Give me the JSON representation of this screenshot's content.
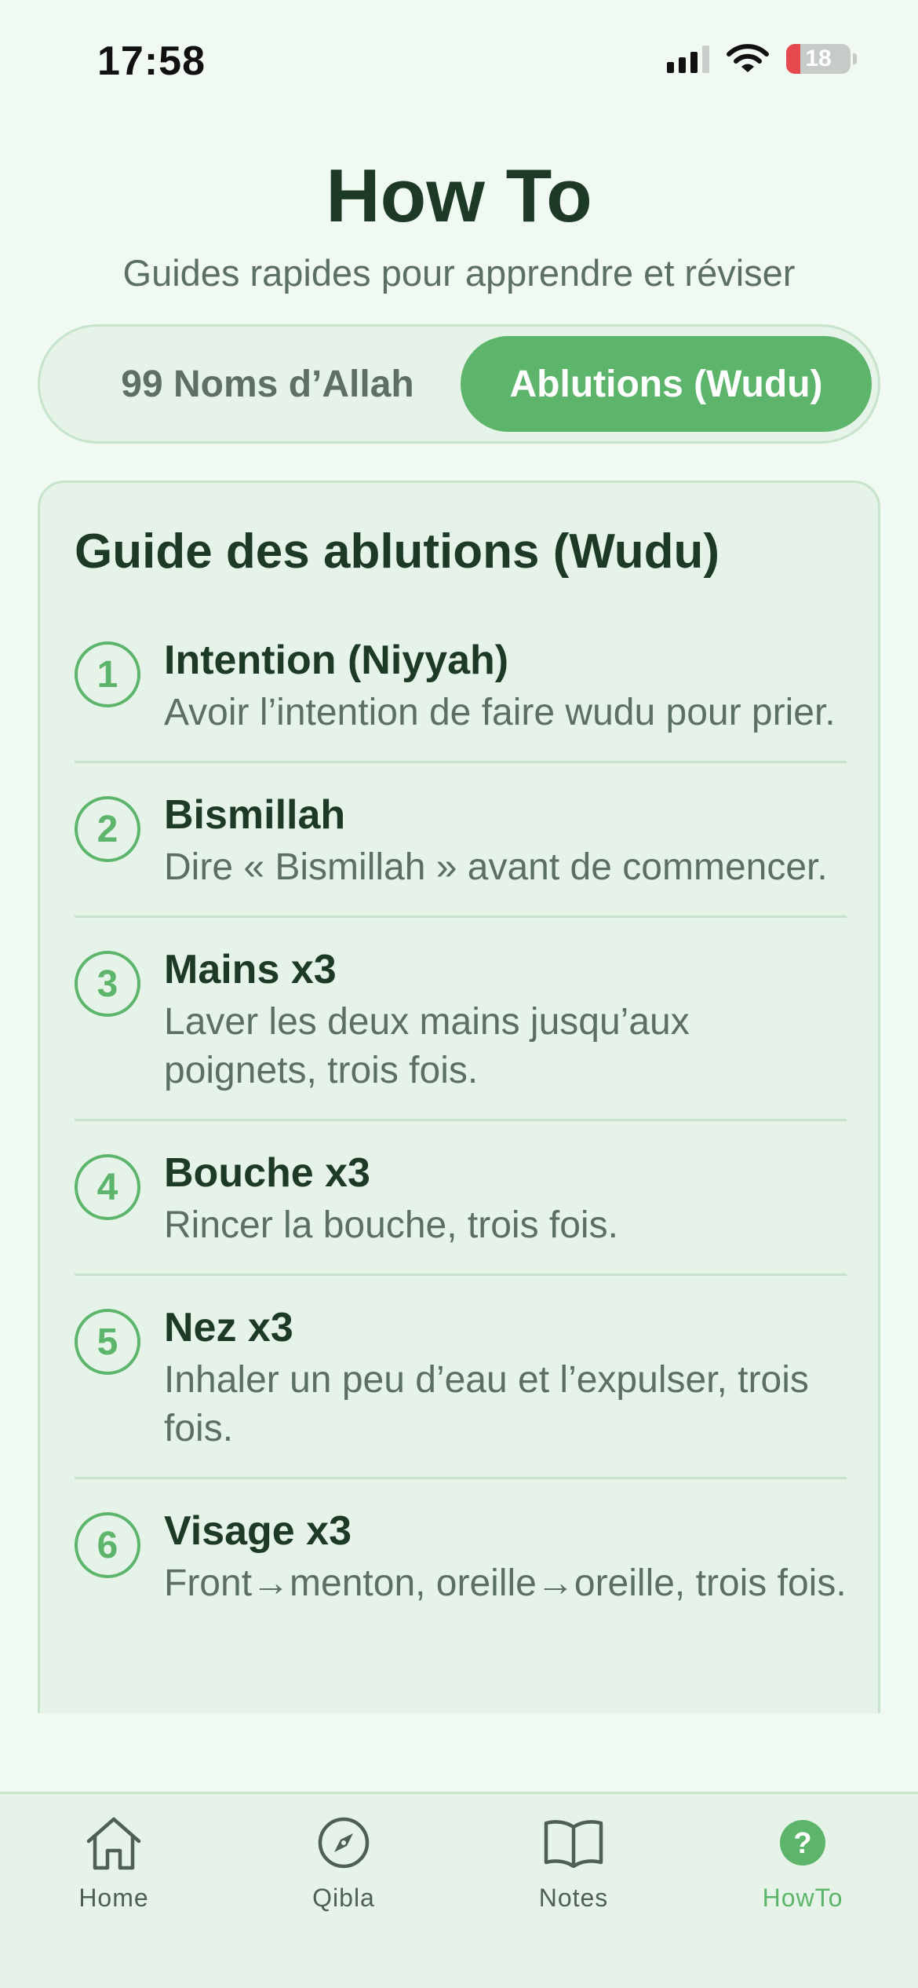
{
  "status_bar": {
    "time": "17:58",
    "battery": "18"
  },
  "header": {
    "title": "How To",
    "subtitle": "Guides rapides pour apprendre et réviser"
  },
  "segmented": {
    "options": [
      "99 Noms d’Allah",
      "Ablutions (Wudu)"
    ],
    "selected": "Ablutions (Wudu)"
  },
  "guide": {
    "title": "Guide des ablutions (Wudu)",
    "steps": [
      {
        "number": "1",
        "title": "Intention (Niyyah)",
        "description": "Avoir l’intention de faire wudu pour prier."
      },
      {
        "number": "2",
        "title": "Bismillah",
        "description": "Dire « Bismillah » avant de commencer."
      },
      {
        "number": "3",
        "title": "Mains x3",
        "description": "Laver les deux mains jusqu’aux poignets, trois fois."
      },
      {
        "number": "4",
        "title": "Bouche x3",
        "description": "Rincer la bouche, trois fois."
      },
      {
        "number": "5",
        "title": "Nez x3",
        "description": "Inhaler un peu d’eau et l’expulser, trois fois."
      },
      {
        "number": "6",
        "title": "Visage x3",
        "description": "Front→menton, oreille→oreille, trois fois."
      }
    ]
  },
  "tabbar": {
    "items": [
      {
        "label": "Home",
        "icon": "house-icon"
      },
      {
        "label": "Qibla",
        "icon": "compass-icon"
      },
      {
        "label": "Notes",
        "icon": "book-icon"
      },
      {
        "label": "HowTo",
        "icon": "question-icon"
      }
    ],
    "active": "HowTo"
  },
  "colors": {
    "accent": "#5cb56b",
    "background": "#f1faf2",
    "card": "#e6f3e8",
    "border": "#c6e4cb",
    "title_text": "#1d3a27",
    "secondary_text": "#5b6f62"
  }
}
